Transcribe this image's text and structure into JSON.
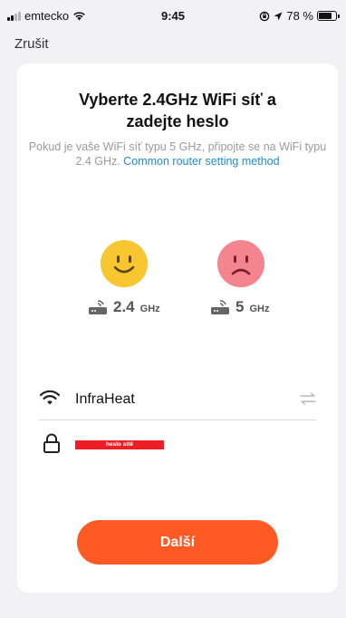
{
  "status_bar": {
    "carrier": "emtecko",
    "time": "9:45",
    "battery": "78 %"
  },
  "nav": {
    "cancel_label": "Zrušit"
  },
  "header": {
    "title": "Vyberte 2.4GHz WiFi síť a zadejte heslo",
    "subtitle": "Pokud je vaše WiFi síť typu 5 GHz, připojte se na WiFi typu 2.4 GHz.",
    "link_text": "Common router setting method"
  },
  "bands": {
    "good": {
      "value": "2.4",
      "unit": "GHz",
      "face": "happy-face-icon"
    },
    "bad": {
      "value": "5",
      "unit": "GHz",
      "face": "sad-face-icon"
    }
  },
  "form": {
    "ssid": "InfraHeat",
    "password_redaction_label": "heslo sítě"
  },
  "actions": {
    "next_label": "Další"
  },
  "colors": {
    "accent": "#ff5a24",
    "link": "#1f8ad6",
    "happy_face": "#f8c630",
    "sad_face": "#f4848e",
    "redaction": "#ee1e24"
  }
}
